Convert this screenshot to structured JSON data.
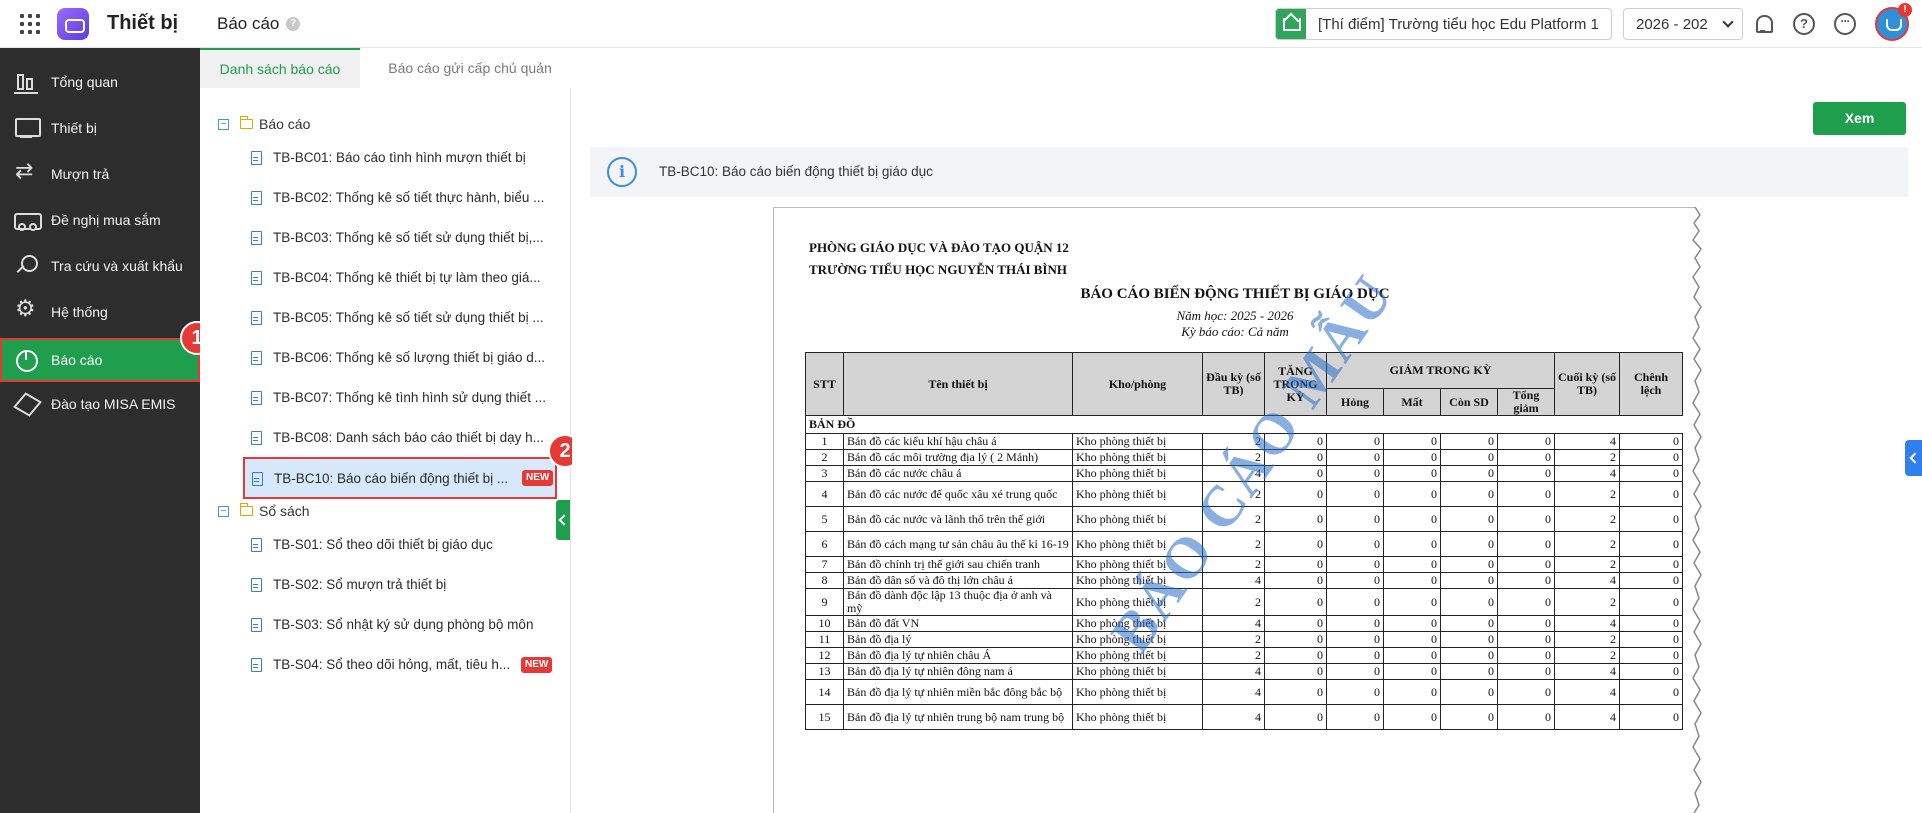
{
  "header": {
    "app_title": "Thiết bị",
    "page_title": "Báo cáo",
    "help_mark": "?",
    "school": "[Thí điểm] Trường tiểu học Edu Platform 1",
    "year": "2026 - 202",
    "more_mark": "···",
    "avatar_badge": "!"
  },
  "sidebar": {
    "items": [
      {
        "label": "Tổng quan",
        "icon": "bar-chart-icon"
      },
      {
        "label": "Thiết bị",
        "icon": "monitor-icon"
      },
      {
        "label": "Mượn trả",
        "icon": "swap-icon"
      },
      {
        "label": "Đề nghị mua sắm",
        "icon": "truck-icon"
      },
      {
        "label": "Tra cứu và xuất khẩu",
        "icon": "search-icon"
      },
      {
        "label": "Hệ thống",
        "icon": "gear-icon"
      },
      {
        "label": "Báo cáo",
        "icon": "pie-chart-icon"
      },
      {
        "label": "Đào tạo MISA EMIS",
        "icon": "cube-icon"
      }
    ]
  },
  "steps": {
    "one": "1",
    "two": "2"
  },
  "tabs": [
    {
      "label": "Danh sách báo cáo"
    },
    {
      "label": "Báo cáo gửi cấp chủ quản"
    }
  ],
  "tree": {
    "group1": {
      "label": "Báo cáo",
      "items": [
        {
          "label": "TB-BC01: Báo cáo tình hình mượn thiết bị"
        },
        {
          "label": "TB-BC02: Thống kê số tiết thực hành, biểu ..."
        },
        {
          "label": "TB-BC03: Thống kê số tiết sử dụng thiết bị,..."
        },
        {
          "label": "TB-BC04: Thống kê thiết bị tự làm theo giá..."
        },
        {
          "label": "TB-BC05: Thống kê số tiết sử dụng thiết bị ..."
        },
        {
          "label": "TB-BC06: Thống kê số lượng thiết bị giáo d..."
        },
        {
          "label": "TB-BC07: Thống kê tình hình sử dụng thiết ..."
        },
        {
          "label": "TB-BC08: Danh sách báo cáo thiết bị dạy h..."
        },
        {
          "label": "TB-BC10: Báo cáo biến động thiết bị ...",
          "badge": "NEW"
        }
      ]
    },
    "group2": {
      "label": "Sổ sách",
      "items": [
        {
          "label": "TB-S01: Sổ theo dõi thiết bị giáo dục"
        },
        {
          "label": "TB-S02: Sổ mượn trả thiết bị"
        },
        {
          "label": "TB-S03: Sổ nhật ký sử dụng phòng bộ môn"
        },
        {
          "label": "TB-S04: Sổ theo dõi hỏng, mất, tiêu h...",
          "badge": "NEW"
        }
      ]
    },
    "toggle_symbol": "−"
  },
  "content": {
    "view_button": "Xem",
    "info_icon": "i",
    "info_text": "TB-BC10: Báo cáo biến động thiết bị giáo dục"
  },
  "report": {
    "org": "PHÒNG GIÁO DỤC VÀ ĐÀO TẠO QUẬN 12",
    "school": "TRƯỜNG TIỂU HỌC NGUYỄN THÁI BÌNH",
    "title": "BÁO CÁO BIẾN ĐỘNG THIẾT BỊ GIÁO DỤC",
    "school_year": "Năm học: 2025 - 2026",
    "period": "Kỳ báo cáo: Cả năm",
    "watermark": "BÁO CÁO MẪU",
    "headers": {
      "stt": "STT",
      "name": "Tên thiết bị",
      "room": "Kho/phòng",
      "start": "Đầu kỳ (số TB)",
      "increase": "TĂNG TRONG",
      "increase_tail": "KỲ",
      "decrease": "GIẢM TRONG KỲ",
      "damaged": "Hỏng",
      "lost": "Mất",
      "expired": "Còn SD",
      "total_dec": "Tổng giảm",
      "end": "Cuối kỳ (số TB)",
      "diff": "Chênh lệch"
    },
    "group_label": "BẢN ĐỒ",
    "rows": [
      {
        "stt": "1",
        "name": "Bản đồ các kiểu khí hậu châu á",
        "room": "Kho phòng thiết bị",
        "start": "2",
        "inc": "0",
        "dmg": "0",
        "lost": "0",
        "sd": "0",
        "tot": "0",
        "end": "4",
        "diff": "0"
      },
      {
        "stt": "2",
        "name": "Bản đồ các môi trường địa lý ( 2 Mảnh)",
        "room": "Kho phòng thiết bị",
        "start": "2",
        "inc": "0",
        "dmg": "0",
        "lost": "0",
        "sd": "0",
        "tot": "0",
        "end": "2",
        "diff": "0"
      },
      {
        "stt": "3",
        "name": "Bản đồ các nước châu á",
        "room": "Kho phòng thiết bị",
        "start": "4",
        "inc": "0",
        "dmg": "0",
        "lost": "0",
        "sd": "0",
        "tot": "0",
        "end": "4",
        "diff": "0"
      },
      {
        "stt": "4",
        "name": "Bản đồ các nước đế quốc xâu xé trung quốc",
        "room": "Kho phòng thiết bị",
        "start": "2",
        "inc": "0",
        "dmg": "0",
        "lost": "0",
        "sd": "0",
        "tot": "0",
        "end": "2",
        "diff": "0"
      },
      {
        "stt": "5",
        "name": "Bản đồ các nước và lãnh thổ trên thế giới",
        "room": "Kho phòng thiết bị",
        "start": "2",
        "inc": "0",
        "dmg": "0",
        "lost": "0",
        "sd": "0",
        "tot": "0",
        "end": "2",
        "diff": "0"
      },
      {
        "stt": "6",
        "name": "Bản đồ cách mạng tư sản châu âu thế kỉ 16-19",
        "room": "Kho phòng thiết bị",
        "start": "2",
        "inc": "0",
        "dmg": "0",
        "lost": "0",
        "sd": "0",
        "tot": "0",
        "end": "2",
        "diff": "0"
      },
      {
        "stt": "7",
        "name": "Bản đồ chính trị thế giới sau chiến tranh",
        "room": "Kho phòng thiết bị",
        "start": "2",
        "inc": "0",
        "dmg": "0",
        "lost": "0",
        "sd": "0",
        "tot": "0",
        "end": "2",
        "diff": "0"
      },
      {
        "stt": "8",
        "name": "Bản đồ dân số và đô thị lớn châu á",
        "room": "Kho phòng thiết bị",
        "start": "4",
        "inc": "0",
        "dmg": "0",
        "lost": "0",
        "sd": "0",
        "tot": "0",
        "end": "4",
        "diff": "0"
      },
      {
        "stt": "9",
        "name": "Bản đồ dành độc lập 13 thuộc địa ở anh và mỹ",
        "room": "Kho phòng thiết bị",
        "start": "2",
        "inc": "0",
        "dmg": "0",
        "lost": "0",
        "sd": "0",
        "tot": "0",
        "end": "2",
        "diff": "0"
      },
      {
        "stt": "10",
        "name": "Bản đồ đất VN",
        "room": "Kho phòng thiết bị",
        "start": "4",
        "inc": "0",
        "dmg": "0",
        "lost": "0",
        "sd": "0",
        "tot": "0",
        "end": "4",
        "diff": "0"
      },
      {
        "stt": "11",
        "name": "Bản đồ địa lý",
        "room": "Kho phòng thiết bị",
        "start": "2",
        "inc": "0",
        "dmg": "0",
        "lost": "0",
        "sd": "0",
        "tot": "0",
        "end": "2",
        "diff": "0"
      },
      {
        "stt": "12",
        "name": "Bản đồ địa lý tự nhiên châu Á",
        "room": "Kho phòng thiết bị",
        "start": "2",
        "inc": "0",
        "dmg": "0",
        "lost": "0",
        "sd": "0",
        "tot": "0",
        "end": "2",
        "diff": "0"
      },
      {
        "stt": "13",
        "name": "Bản đồ địa lý tự nhiên đông nam á",
        "room": "Kho phòng thiết bị",
        "start": "4",
        "inc": "0",
        "dmg": "0",
        "lost": "0",
        "sd": "0",
        "tot": "0",
        "end": "4",
        "diff": "0"
      },
      {
        "stt": "14",
        "name": "Bản đồ địa lý tự nhiên miền bắc đông bắc bộ",
        "room": "Kho phòng thiết bị",
        "start": "4",
        "inc": "0",
        "dmg": "0",
        "lost": "0",
        "sd": "0",
        "tot": "0",
        "end": "4",
        "diff": "0"
      },
      {
        "stt": "15",
        "name": "Bản đồ địa lý tự nhiên trung bộ nam trung bộ",
        "room": "Kho phòng thiết bị",
        "start": "4",
        "inc": "0",
        "dmg": "0",
        "lost": "0",
        "sd": "0",
        "tot": "0",
        "end": "4",
        "diff": "0"
      }
    ]
  },
  "colors": {
    "accent": "#1f9e4e",
    "sidebar_bg": "#2d2d2d",
    "highlight_border": "#e53935",
    "selected_bg": "#d7e8fb",
    "watermark": "#286ec8"
  }
}
